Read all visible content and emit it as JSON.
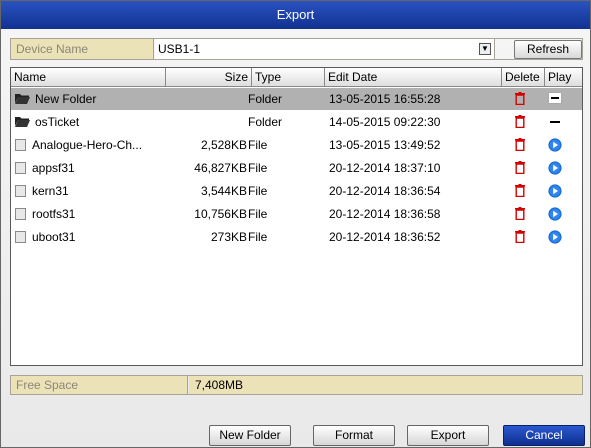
{
  "dialog": {
    "title": "Export"
  },
  "device": {
    "label": "Device Name",
    "selected": "USB1-1",
    "refresh_label": "Refresh"
  },
  "table": {
    "headers": {
      "name": "Name",
      "size": "Size",
      "type": "Type",
      "date": "Edit Date",
      "delete": "Delete",
      "play": "Play"
    },
    "rows": [
      {
        "name": "New Folder",
        "size": "",
        "type": "Folder",
        "date": "13-05-2015 16:55:28",
        "kind": "folder",
        "play": "dash-box",
        "selected": true
      },
      {
        "name": "osTicket",
        "size": "",
        "type": "Folder",
        "date": "14-05-2015 09:22:30",
        "kind": "folder",
        "play": "dash",
        "selected": false
      },
      {
        "name": "Analogue-Hero-Ch...",
        "size": "2,528KB",
        "type": "File",
        "date": "13-05-2015 13:49:52",
        "kind": "file",
        "play": "play",
        "selected": false
      },
      {
        "name": "appsf31",
        "size": "46,827KB",
        "type": "File",
        "date": "20-12-2014 18:37:10",
        "kind": "file",
        "play": "play",
        "selected": false
      },
      {
        "name": "kern31",
        "size": "3,544KB",
        "type": "File",
        "date": "20-12-2014 18:36:54",
        "kind": "file",
        "play": "play",
        "selected": false
      },
      {
        "name": "rootfs31",
        "size": "10,756KB",
        "type": "File",
        "date": "20-12-2014 18:36:58",
        "kind": "file",
        "play": "play",
        "selected": false
      },
      {
        "name": "uboot31",
        "size": "273KB",
        "type": "File",
        "date": "20-12-2014 18:36:52",
        "kind": "file",
        "play": "play",
        "selected": false
      }
    ]
  },
  "free_space": {
    "label": "Free Space",
    "value": "7,408MB"
  },
  "buttons": {
    "new_folder": "New Folder",
    "format": "Format",
    "export": "Export",
    "cancel": "Cancel"
  },
  "colors": {
    "title_bar": "#1a3fae",
    "selected_row": "#b1b1b1",
    "field_label_bg": "#ece2b7",
    "delete_icon": "#d40000",
    "play_icon": "#1d6fd6"
  },
  "icons": {
    "folder": "folder-icon",
    "file": "file-icon",
    "delete": "trash-icon",
    "play": "play-icon",
    "dropdown": "chevron-down-icon"
  }
}
